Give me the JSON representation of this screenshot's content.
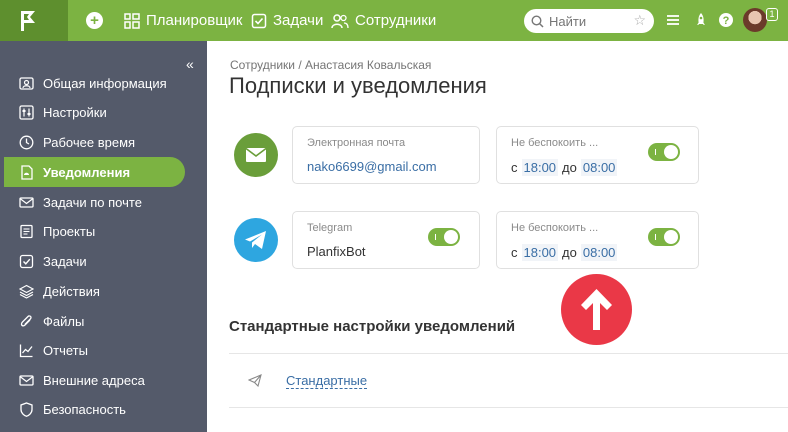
{
  "topbar": {
    "nav": [
      {
        "label": "Планировщик",
        "icon": "grid-icon"
      },
      {
        "label": "Задачи",
        "icon": "checkbox-icon"
      },
      {
        "label": "Сотрудники",
        "icon": "people-icon"
      }
    ],
    "search_placeholder": "Найти",
    "notification_count": "1"
  },
  "sidebar": {
    "items": [
      {
        "label": "Общая информация",
        "icon": "person-card-icon"
      },
      {
        "label": "Настройки",
        "icon": "sliders-icon"
      },
      {
        "label": "Рабочее время",
        "icon": "clock-icon"
      },
      {
        "label": "Уведомления",
        "icon": "bell-doc-icon",
        "active": true
      },
      {
        "label": "Задачи по почте",
        "icon": "mail-icon"
      },
      {
        "label": "Проекты",
        "icon": "folder-icon"
      },
      {
        "label": "Задачи",
        "icon": "checkbox-icon"
      },
      {
        "label": "Действия",
        "icon": "layers-icon"
      },
      {
        "label": "Файлы",
        "icon": "paperclip-icon"
      },
      {
        "label": "Отчеты",
        "icon": "chart-icon"
      },
      {
        "label": "Внешние адреса",
        "icon": "mail-outline-icon"
      },
      {
        "label": "Безопасность",
        "icon": "shield-icon"
      }
    ]
  },
  "main": {
    "breadcrumb": "Сотрудники / Анастасия Ковальская",
    "title": "Подписки и уведомления",
    "email_card": {
      "label": "Электронная почта",
      "value": "nako6699@gmail.com"
    },
    "email_dnd": {
      "label": "Не беспокоить ...",
      "from_prefix": "с",
      "from": "18:00",
      "to_prefix": "до",
      "to": "08:00"
    },
    "telegram_card": {
      "label": "Telegram",
      "value": "PlanfixBot"
    },
    "telegram_dnd": {
      "label": "Не беспокоить ...",
      "from_prefix": "с",
      "from": "18:00",
      "to_prefix": "до",
      "to": "08:00"
    },
    "section_title": "Стандартные настройки уведомлений",
    "standard_link": "Стандартные"
  },
  "colors": {
    "accent": "#7cb342",
    "sidebar": "#545a6a",
    "email": "#6a9e3a",
    "telegram": "#2ea6e0",
    "alert": "#ea3847"
  }
}
